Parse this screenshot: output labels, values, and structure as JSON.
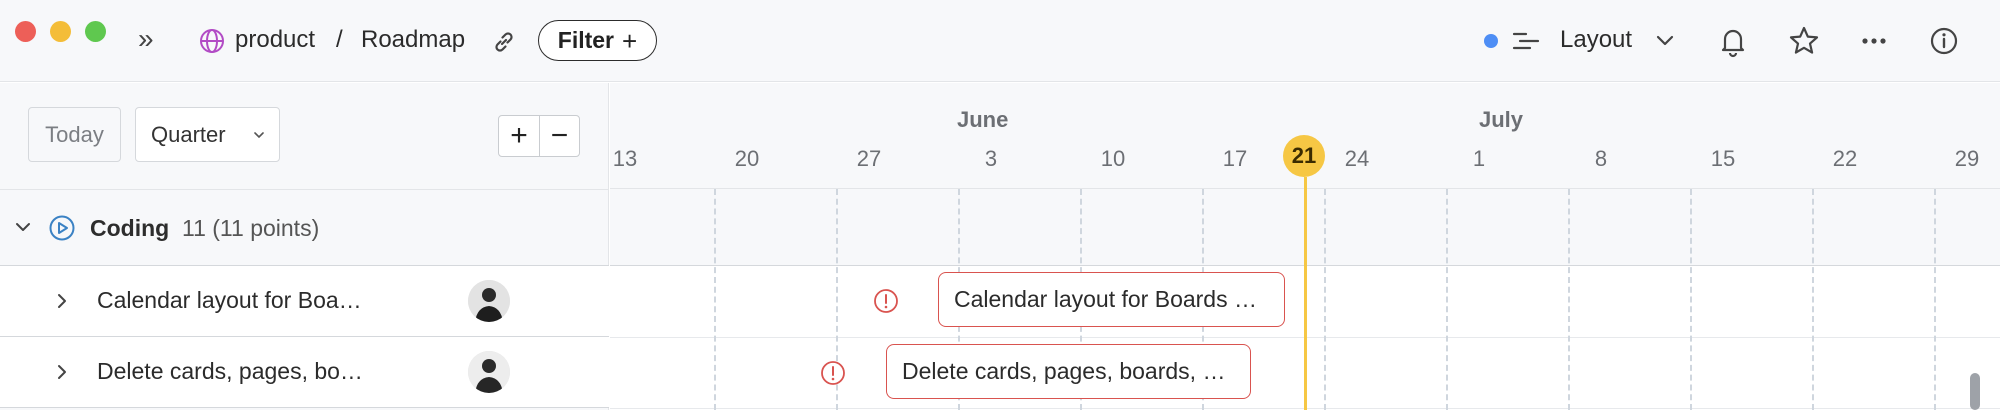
{
  "titlebar": {
    "breadcrumb_workspace": "product",
    "breadcrumb_separator": "/",
    "breadcrumb_page": "Roadmap",
    "filter_label": "Filter",
    "filter_plus": "+",
    "layout_label": "Layout",
    "status_dot_color": "#4e8ef5"
  },
  "controls": {
    "today_label": "Today",
    "range_value": "Quarter",
    "zoom_in": "+",
    "zoom_out": "−"
  },
  "timeline": {
    "months": [
      "June",
      "July"
    ],
    "days": [
      "13",
      "20",
      "27",
      "3",
      "10",
      "17",
      "21",
      "24",
      "1",
      "8",
      "15",
      "22",
      "29"
    ],
    "today": "21",
    "today_color": "#f6c744"
  },
  "group": {
    "name": "Coding",
    "count": "11 (11 points)"
  },
  "tasks": [
    {
      "label": "Calendar layout for Boa…",
      "bar_label": "Calendar layout for Boards …"
    },
    {
      "label": "Delete cards, pages, bo…",
      "bar_label": "Delete cards, pages, boards, …"
    }
  ],
  "colors": {
    "overdue_border": "#d9534f",
    "accent": "#4e8ef5"
  }
}
